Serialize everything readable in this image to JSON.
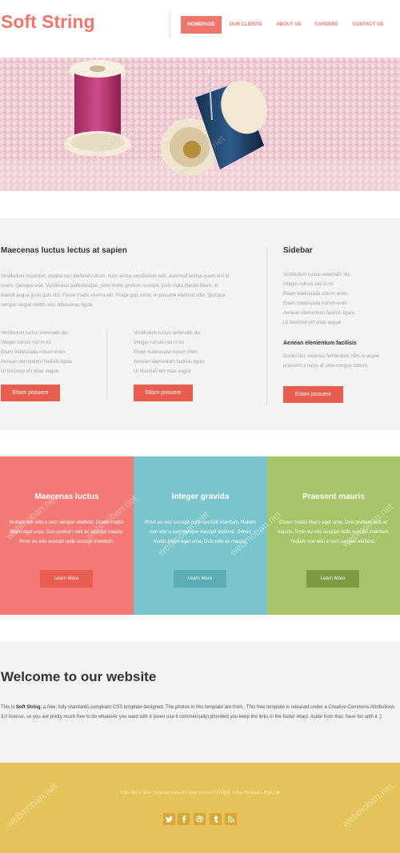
{
  "header": {
    "logo": "Soft String",
    "nav": [
      "HOMEPAGE",
      "OUR CLIENTS",
      "ABOUT US",
      "CAREERS",
      "CONTACT US"
    ]
  },
  "main": {
    "heading": "Maecenas luctus lectus at sapien",
    "paragraph": "Vestibulum imperdiet, magna nec eleifend rutrum, nunc lectus vestibulum velit, euismod lacinia quam nisl id lorem. Quisque erat. Vestibulum pellentesque, justo mollis pretium suscipit, justo nulla blandit libero, in blandit augue justo quis nisl. Fusce mattis viverra elit. Fusce quis tortor. In posuere eleifend odio. Quisque semper augue mattis wisi. Maecenas ligula.",
    "list_left": [
      "Vestibulum luctus venenatis dui",
      "Integer rutrum nisl in mi",
      "Etiam malesuada rutrum enim",
      "Aenean elementum facilisis ligula",
      "Ut tincidunt elit vitae augue"
    ],
    "list_right": [
      "Vestibulum luctus venenatis dui",
      "Integer rutrum nisl in mi",
      "Etiam malesuada rutrum enim",
      "Aenean elementum facilisis ligula",
      "Ut tincidunt elit vitae augue"
    ],
    "button_label": "Etiam posuere"
  },
  "sidebar": {
    "heading": "Sidebar",
    "list": [
      "Vestibulum luctus venenatis dui",
      "Integer rutrum nisl in mi",
      "Etiam malesuada rutrum enim",
      "Etiam malesuada rutrum enim",
      "Aenean elementum facilisis ligula",
      "Ut tincidunt elit vitae augue"
    ],
    "subheading": "Aenean elementum facilisis",
    "text": "Donec leo, vivamus fermentum nibh in augue praesent a lacus at urna congue rutrum.",
    "button_label": "Etiam posuere"
  },
  "boxes": [
    {
      "title": "Maecenas luctus",
      "text": "Nullam non wisi a sem semper eleifend. Donec mattis libero eget urna. Duis pretium velit ac suscipit mauris. Proin eu wisi suscipit nulla suscipit interdum.",
      "button": "Learn More",
      "bg": "#f47a76",
      "btn_bg": "#e85d4f"
    },
    {
      "title": "Integer gravida",
      "text": "Proin eu wisi suscipit nulla suscipit interdum. Nullam non wisi a sem semper suscipit eleifend. Donec mattis libero eget urna. Duis velit ac mauris.",
      "button": "Learn More",
      "bg": "#79c5cb",
      "btn_bg": "#5aaeb4"
    },
    {
      "title": "Praesent mauris",
      "text": "Donec mattis libero eget urna. Duis pretium velit ac mauris. Proin eu wisi suscipit nulla suscipit interdum. Nullam non wisi a sem semper eleifend.",
      "button": "Learn More",
      "bg": "#a7c568",
      "btn_bg": "#7e9a41"
    }
  ],
  "welcome": {
    "title": "Welcome to our website",
    "text_before": "This is ",
    "text_bold": "Soft String",
    "text_after": ", a free, fully standards-compliant CSS template designed. The photos in this template are from . This free template is released under a Creative Commons Attributions 3.0 license, so you are pretty much free to do whatever you want with it (even use it commercially) provided you keep the links in the footer intact. Aside from that, have fun with it :)"
  },
  "footer": {
    "copyright": "Copyright © 2014 Company name All rights reserved 网页模板 - More Templates 模板之家",
    "social_icons": [
      "twitter-icon",
      "facebook-icon",
      "dribbble-icon",
      "tumblr-icon",
      "rss-icon"
    ]
  },
  "watermark": "webmoban.net",
  "colors": {
    "accent": "#f0766c",
    "button": "#e85d4f",
    "footer": "#e5c35b"
  }
}
